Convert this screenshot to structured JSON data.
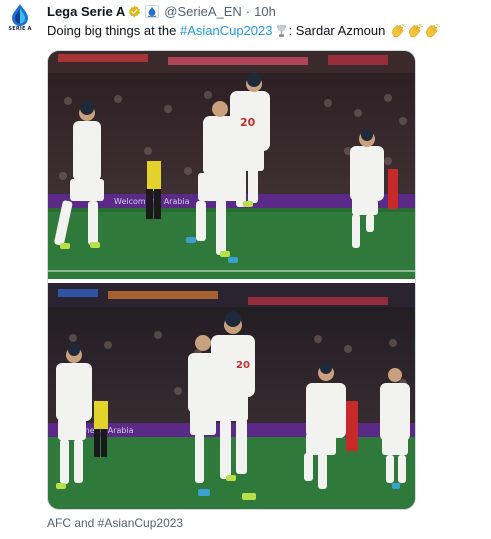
{
  "account": {
    "name": "Lega Serie A",
    "handle": "@SerieA_EN",
    "separator": "·",
    "time": "10h",
    "logo_text": "SERIE A",
    "avatar_icon": "serie-a-logo-icon",
    "verified_icon": "gold-verified-badge-icon",
    "affiliation_icon": "affiliate-badge-icon"
  },
  "tweet": {
    "text_before": "Doing big things at the ",
    "hashtag": "#AsianCup2023",
    "text_after": ": Sardar Azmoun",
    "emoji_trophy": "trophy-emoji",
    "emoji_claps": [
      "clapping-hands-emoji",
      "clapping-hands-emoji",
      "clapping-hands-emoji"
    ]
  },
  "media": {
    "photos": [
      {
        "name": "photo-celebration-1",
        "jersey_number": "20",
        "ad_board_text": "Welcome to Arabia"
      },
      {
        "name": "photo-celebration-2",
        "jersey_number": "20",
        "ad_board_text": "Welcome to Arabia"
      }
    ]
  },
  "credit": "AFC and #AsianCup2023",
  "colors": {
    "link": "#1d9bf0",
    "secondary_text": "#536471",
    "pitch": "#2f7a3a",
    "kit_white": "#f2f2f0",
    "ad_board_purple": "#5a2a86",
    "verified_gold": "#e2b719"
  }
}
